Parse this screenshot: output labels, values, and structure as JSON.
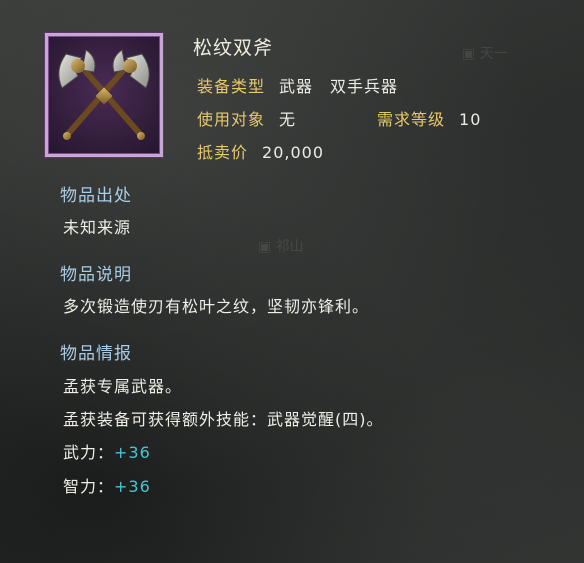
{
  "item": {
    "name": "松纹双斧",
    "icon": "twin-axes-icon",
    "type_label": "装备类型",
    "type_value": "武器　双手兵器",
    "target_label": "使用对象",
    "target_value": "无",
    "level_label": "需求等级",
    "level_value": "10",
    "price_label": "抵卖价",
    "price_value": "20,000"
  },
  "source": {
    "title": "物品出处",
    "text": "未知来源"
  },
  "description": {
    "title": "物品说明",
    "text": "多次锻造使刃有松叶之纹，坚韧亦锋利。"
  },
  "intel": {
    "title": "物品情报",
    "line1": "孟获专属武器。",
    "line2": "孟获装备可获得额外技能：武器觉醒(四)。",
    "stats": [
      {
        "label": "武力：",
        "value": "+36"
      },
      {
        "label": "智力：",
        "value": "+36"
      }
    ]
  },
  "watermark": {
    "text1": "天一",
    "text2": "祁山"
  },
  "colors": {
    "frame": "#c9a6d6",
    "label": "#e7c96a",
    "section": "#a9cde6",
    "stat": "#46c6d2"
  }
}
